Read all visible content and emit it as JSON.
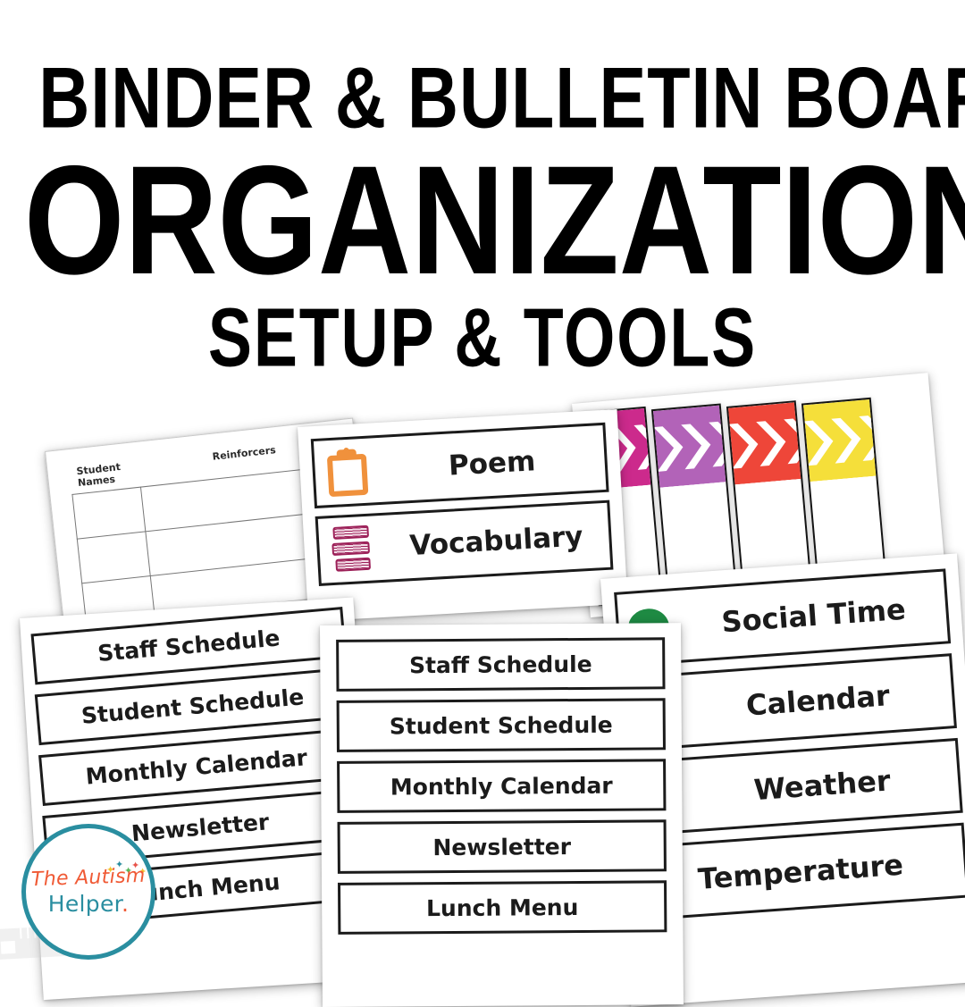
{
  "title": {
    "line1": "Binder & Bulletin Board",
    "line2": "Organization",
    "line3": "Setup & Tools"
  },
  "data_sheet": {
    "name": "student-reinforcers-sheet",
    "col_headers": [
      "Student Names",
      "Reinforcers"
    ],
    "row_count": 3
  },
  "poem_card": {
    "rows": [
      {
        "label": "Poem",
        "icon": "clipboard-icon",
        "color": "#F0913C"
      },
      {
        "label": "Vocabulary",
        "icon": "books-icon",
        "color": "#9C2058"
      }
    ]
  },
  "chevron_strips": {
    "colors": [
      "#CC2A8C",
      "#B263B8",
      "#EE4639",
      "#F5DF3A"
    ],
    "names": [
      "magenta-chevron-strip",
      "purple-chevron-strip",
      "red-chevron-strip",
      "yellow-chevron-strip"
    ]
  },
  "left_card": {
    "labels": [
      "Staff Schedule",
      "Student Schedule",
      "Monthly Calendar",
      "Newsletter",
      "Lunch Menu"
    ]
  },
  "center_card": {
    "labels": [
      "Staff Schedule",
      "Student Schedule",
      "Monthly Calendar",
      "Newsletter",
      "Lunch Menu"
    ]
  },
  "right_card": {
    "rows": [
      {
        "label": "Social Time",
        "icon": "green-circle-icon",
        "color": "#1E8A43"
      },
      {
        "label": "Calendar",
        "icon": "calendar-icon",
        "color": "#3B8FD4"
      },
      {
        "label": "Weather",
        "icon": "cloud-icon",
        "color": "#A77BC0"
      },
      {
        "label": "Temperature",
        "icon": "none",
        "color": ""
      }
    ]
  },
  "logo": {
    "line1": "The Autism",
    "line2": "Helper",
    "period": ".",
    "ring_color": "#2A8EA0",
    "script_color": "#F05A35",
    "star_colors": [
      "#F2C230",
      "#2A8EA0",
      "#5BB85B",
      "#E8534A",
      "#F2C230"
    ]
  }
}
